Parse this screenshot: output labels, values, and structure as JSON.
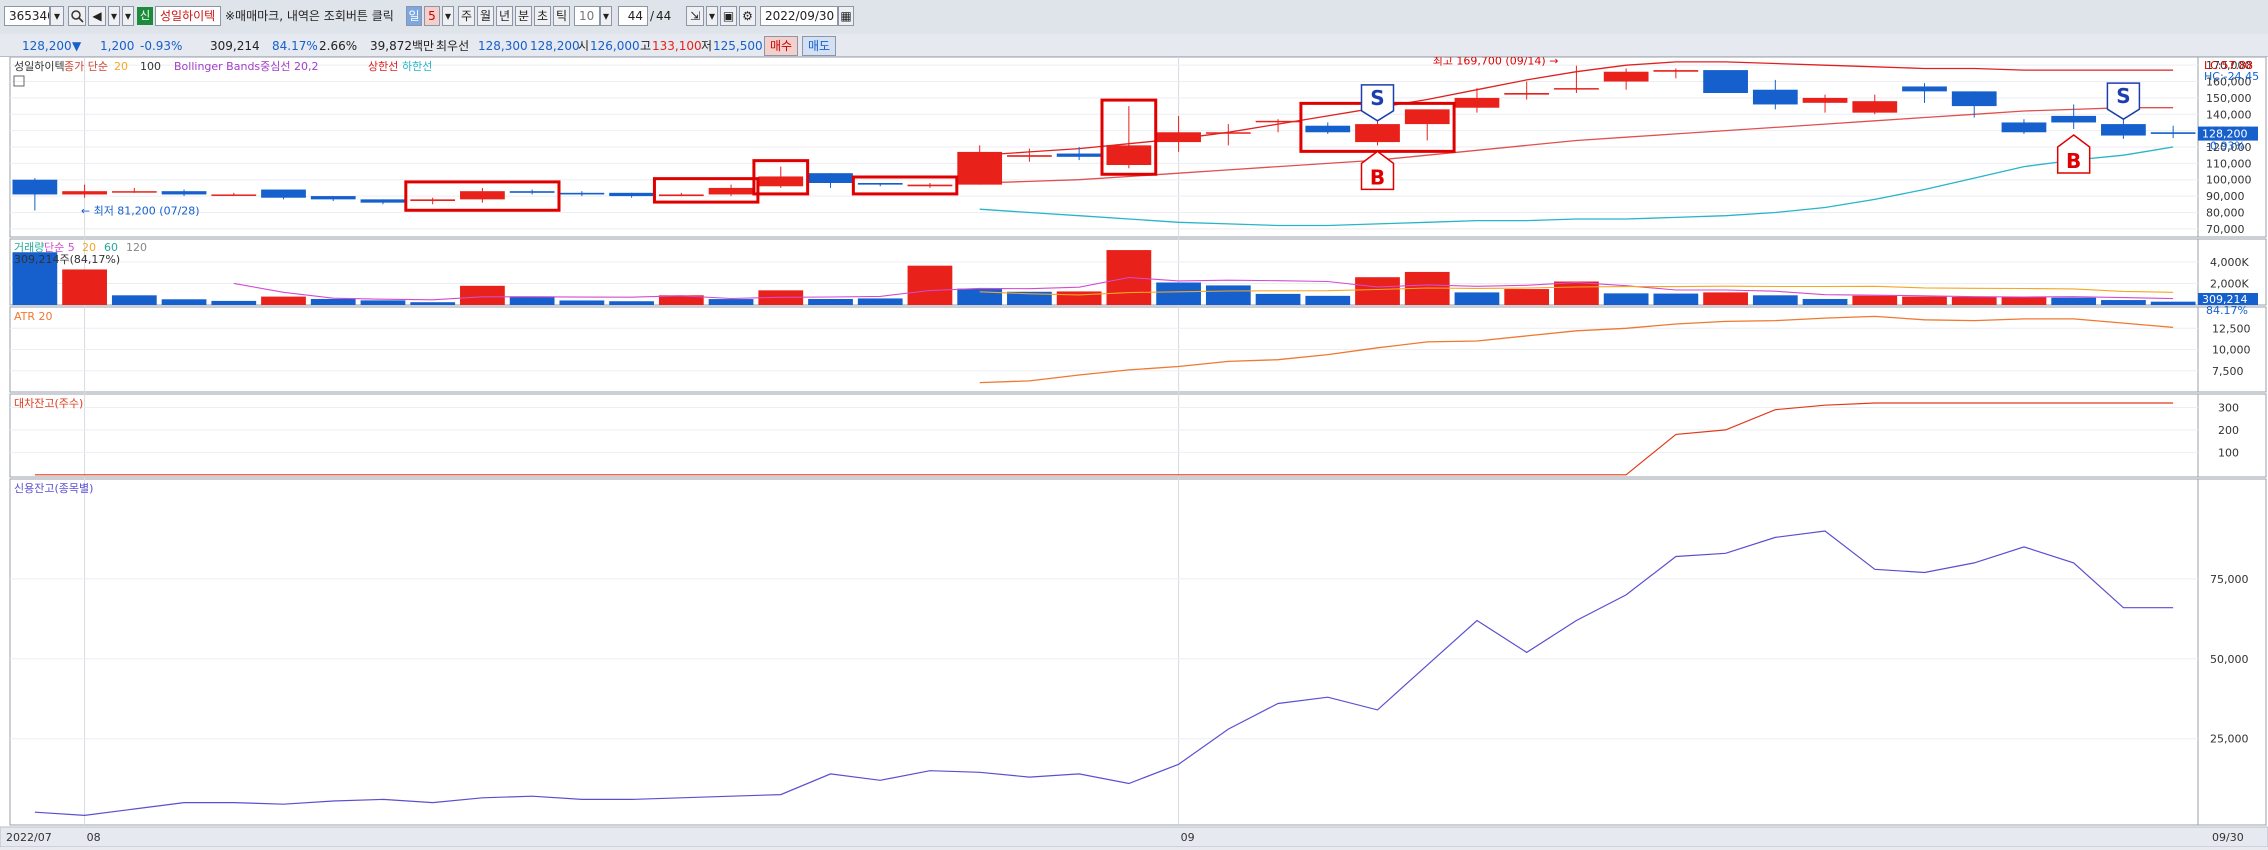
{
  "toolbar": {
    "code": "365340",
    "name_badge": "신",
    "name": "성일하이텍",
    "notice": "※매매마크, 내역은 조회버튼 클릭",
    "period_buttons": [
      "일",
      "5",
      "주",
      "월",
      "년",
      "분",
      "초",
      "틱"
    ],
    "tick_value": "10",
    "count": "44",
    "count_total": "44",
    "date": "2022/09/30"
  },
  "quote": {
    "price": "128,200",
    "arrow": "▼",
    "change": "1,200",
    "change_pct": "-0.93%",
    "volume": "309,214",
    "vol_ratio": "84.17%",
    "turnover": "2.66%",
    "amount": "39,872백만",
    "pref_label": "최우선",
    "best_ask": "128,300",
    "best_bid": "128,200",
    "open_label": "시",
    "open": "126,000",
    "high_label": "고",
    "high": "133,100",
    "low_label": "저",
    "low": "125,500",
    "buy_label": "매수",
    "sell_label": "매도"
  },
  "panels": {
    "price": {
      "name": "성일하이텍",
      "ma_label": "종가 단순",
      "ma1": "20",
      "ma2": "100",
      "bb_label": "Bollinger Bands중심선 20,2",
      "upper_label": "상한선",
      "lower_label": "하한선",
      "lc": "LC:57.88",
      "hc": "HC:-24.45",
      "max_annotation": "최고 169,700 (09/14)",
      "min_annotation": "최저 81,200 (07/28)",
      "last_price_tag": "128,200",
      "last_pct_tag": "-0.93%",
      "y_ticks": [
        "170,000",
        "160,000",
        "150,000",
        "140,000",
        "130,000",
        "120,000",
        "110,000",
        "100,000",
        "90,000",
        "80,000",
        "70,000"
      ]
    },
    "volume": {
      "name": "거래량",
      "ma_label": "단순 5",
      "ma2": "20",
      "ma3": "60",
      "ma4": "120",
      "last_label": "309,214주(84,17%)",
      "tag_value": "309,214",
      "tag_pct": "84.17%",
      "y_ticks": [
        "4,000K",
        "2,000K"
      ]
    },
    "atr": {
      "name": "ATR 20",
      "y_ticks": [
        "12,500",
        "10,000",
        "7,500"
      ]
    },
    "loan": {
      "name": "대차잔고(주수)",
      "y_ticks": [
        "300",
        "200",
        "100"
      ]
    },
    "credit": {
      "name": "신용잔고(종목별)",
      "y_ticks": [
        "75,000",
        "50,000",
        "25,000"
      ]
    }
  },
  "x_axis": {
    "start": "2022/07",
    "aug": "08",
    "sep": "09",
    "end": "09/30"
  },
  "signals": {
    "buy": "B",
    "sell": "S"
  },
  "colors": {
    "up": "#e8211b",
    "down": "#1560cc",
    "ma20": "#f5a623",
    "bb_upper": "#e02020",
    "bb_lower": "#27b5c8",
    "atr": "#f07830",
    "loan": "#e23a1a",
    "credit": "#5b4fd1"
  },
  "chart_data": [
    {
      "type": "candlestick",
      "title": "성일하이텍",
      "x": [
        "07/28",
        "07/29",
        "08/01",
        "08/02",
        "08/03",
        "08/04",
        "08/05",
        "08/08",
        "08/09",
        "08/10",
        "08/11",
        "08/12",
        "08/16",
        "08/17",
        "08/18",
        "08/19",
        "08/22",
        "08/23",
        "08/24",
        "08/25",
        "08/26",
        "08/29",
        "08/30",
        "08/31",
        "09/01",
        "09/02",
        "09/05",
        "09/06",
        "09/07",
        "09/08",
        "09/13",
        "09/14",
        "09/15",
        "09/16",
        "09/19",
        "09/20",
        "09/21",
        "09/22",
        "09/23",
        "09/26",
        "09/27",
        "09/28",
        "09/29",
        "09/30"
      ],
      "open": [
        100000,
        91000,
        93000,
        93000,
        91000,
        94000,
        90000,
        88000,
        87000,
        88000,
        93000,
        92000,
        92000,
        90000,
        91000,
        96000,
        104000,
        98000,
        96000,
        97000,
        114000,
        116000,
        109000,
        123000,
        129000,
        136000,
        133000,
        123000,
        134000,
        144000,
        152000,
        156000,
        160000,
        166000,
        167000,
        155000,
        147000,
        141000,
        157000,
        154000,
        135000,
        139000,
        134000,
        129000
      ],
      "close": [
        91000,
        93000,
        93000,
        91000,
        91000,
        89000,
        88000,
        86000,
        88000,
        93000,
        92000,
        91000,
        90000,
        91000,
        95000,
        102000,
        98000,
        97000,
        97000,
        117000,
        115000,
        114000,
        121000,
        129000,
        129000,
        136000,
        129000,
        134000,
        143000,
        150000,
        153000,
        156000,
        166000,
        167000,
        153000,
        146000,
        150000,
        148000,
        154000,
        145000,
        129000,
        135000,
        127000,
        128000
      ],
      "high": [
        101000,
        97000,
        95000,
        94000,
        92000,
        94000,
        90000,
        88000,
        89000,
        95000,
        94000,
        93000,
        92000,
        92000,
        97000,
        108000,
        104000,
        98000,
        98000,
        121000,
        119000,
        120000,
        145000,
        139000,
        134000,
        137000,
        135000,
        136000,
        143000,
        156000,
        160000,
        169700,
        168000,
        168000,
        167000,
        161000,
        152000,
        152000,
        159000,
        154000,
        137000,
        146000,
        137000,
        133000
      ],
      "low": [
        81200,
        89000,
        92000,
        90000,
        90000,
        88000,
        87000,
        85000,
        85000,
        86000,
        91000,
        90000,
        89000,
        90000,
        90000,
        95000,
        95000,
        96000,
        95000,
        97000,
        111000,
        112000,
        107000,
        117000,
        121000,
        129000,
        128000,
        121000,
        124000,
        141000,
        149000,
        153000,
        155000,
        162000,
        155000,
        143000,
        141000,
        140000,
        147000,
        138000,
        128000,
        131000,
        125000,
        125500
      ],
      "xlabel": "",
      "ylabel": "",
      "ylim": [
        65000,
        175000
      ],
      "bollinger_upper": [
        null,
        null,
        null,
        null,
        null,
        null,
        null,
        null,
        null,
        null,
        null,
        null,
        null,
        null,
        null,
        null,
        null,
        null,
        null,
        115000,
        117000,
        119000,
        122000,
        125000,
        129000,
        134000,
        139000,
        144000,
        149000,
        155000,
        161000,
        166000,
        170000,
        172000,
        172000,
        171000,
        170000,
        169000,
        168000,
        168000,
        167000,
        167000,
        167000,
        167000
      ],
      "bollinger_lower": [
        null,
        null,
        null,
        null,
        null,
        null,
        null,
        null,
        null,
        null,
        null,
        null,
        null,
        null,
        null,
        null,
        null,
        null,
        null,
        82000,
        80000,
        78000,
        76000,
        74000,
        73000,
        72000,
        72000,
        73000,
        74000,
        75000,
        75000,
        76000,
        76000,
        77000,
        78000,
        80000,
        83000,
        88000,
        94000,
        101000,
        108000,
        112000,
        115000,
        120000
      ],
      "ma100": [
        null,
        null,
        null,
        null,
        null,
        null,
        null,
        null,
        null,
        null,
        null,
        null,
        null,
        null,
        null,
        null,
        null,
        null,
        null,
        98000,
        99000,
        100000,
        102000,
        104000,
        106000,
        108000,
        110000,
        112000,
        115000,
        118000,
        121000,
        124000,
        126000,
        128000,
        130000,
        132000,
        134000,
        136000,
        138000,
        140000,
        142000,
        143000,
        144000,
        144000
      ],
      "signals": [
        {
          "x": "09/06",
          "type": "S"
        },
        {
          "x": "09/06",
          "type": "B"
        },
        {
          "x": "09/29",
          "type": "S"
        },
        {
          "x": "09/28",
          "type": "B"
        }
      ]
    },
    {
      "type": "bar",
      "title": "거래량",
      "x": [
        "07/28",
        "07/29",
        "08/01",
        "08/02",
        "08/03",
        "08/04",
        "08/05",
        "08/08",
        "08/09",
        "08/10",
        "08/11",
        "08/12",
        "08/16",
        "08/17",
        "08/18",
        "08/19",
        "08/22",
        "08/23",
        "08/24",
        "08/25",
        "08/26",
        "08/29",
        "08/30",
        "08/31",
        "09/01",
        "09/02",
        "09/05",
        "09/06",
        "09/07",
        "09/08",
        "09/13",
        "09/14",
        "09/15",
        "09/16",
        "09/19",
        "09/20",
        "09/21",
        "09/22",
        "09/23",
        "09/26",
        "09/27",
        "09/28",
        "09/29",
        "09/30"
      ],
      "values": [
        4900000,
        3300000,
        900000,
        530000,
        380000,
        780000,
        560000,
        430000,
        260000,
        1780000,
        800000,
        420000,
        350000,
        900000,
        550000,
        1360000,
        560000,
        610000,
        3650000,
        1520000,
        1230000,
        1260000,
        5100000,
        2090000,
        1820000,
        1030000,
        850000,
        2580000,
        3070000,
        1170000,
        1480000,
        2180000,
        1080000,
        1060000,
        1170000,
        900000,
        560000,
        860000,
        780000,
        740000,
        780000,
        680000,
        460000,
        309214
      ],
      "up": [
        false,
        true,
        false,
        false,
        false,
        true,
        false,
        false,
        false,
        true,
        false,
        false,
        false,
        true,
        false,
        true,
        false,
        false,
        true,
        false,
        false,
        true,
        true,
        false,
        false,
        false,
        false,
        true,
        true,
        false,
        true,
        true,
        false,
        false,
        true,
        false,
        false,
        true,
        true,
        true,
        true,
        false,
        false,
        false
      ],
      "ylim": [
        0,
        5200000
      ]
    },
    {
      "type": "line",
      "title": "ATR 20",
      "x": [
        "08/25",
        "08/26",
        "08/29",
        "08/30",
        "08/31",
        "09/01",
        "09/02",
        "09/05",
        "09/06",
        "09/07",
        "09/08",
        "09/13",
        "09/14",
        "09/15",
        "09/16",
        "09/19",
        "09/20",
        "09/21",
        "09/22",
        "09/23",
        "09/26",
        "09/27",
        "09/28",
        "09/29",
        "09/30"
      ],
      "values": [
        6100,
        6300,
        7000,
        7600,
        8000,
        8600,
        8800,
        9400,
        10200,
        10900,
        11000,
        11600,
        12200,
        12500,
        13000,
        13300,
        13400,
        13700,
        13900,
        13500,
        13400,
        13600,
        13600,
        13100,
        12600
      ],
      "ylim": [
        5000,
        15000
      ]
    },
    {
      "type": "line",
      "title": "대차잔고(주수)",
      "x": [
        "07/28",
        "09/15",
        "09/16",
        "09/19",
        "09/20",
        "09/21",
        "09/22",
        "09/23",
        "09/26",
        "09/27",
        "09/28",
        "09/29",
        "09/30"
      ],
      "values": [
        0,
        0,
        180,
        200,
        290,
        310,
        320,
        320,
        320,
        320,
        320,
        320,
        320
      ],
      "ylim": [
        -10,
        360
      ]
    },
    {
      "type": "line",
      "title": "신용잔고(종목별)",
      "x": [
        "07/28",
        "07/29",
        "08/01",
        "08/02",
        "08/03",
        "08/04",
        "08/05",
        "08/08",
        "08/09",
        "08/10",
        "08/11",
        "08/12",
        "08/16",
        "08/17",
        "08/18",
        "08/19",
        "08/22",
        "08/23",
        "08/24",
        "08/25",
        "08/26",
        "08/29",
        "08/30",
        "08/31",
        "09/01",
        "09/02",
        "09/05",
        "09/06",
        "09/07",
        "09/08",
        "09/13",
        "09/14",
        "09/15",
        "09/16",
        "09/19",
        "09/20",
        "09/21",
        "09/22",
        "09/23",
        "09/26",
        "09/27",
        "09/28",
        "09/29",
        "09/30"
      ],
      "values": [
        2000,
        1000,
        3000,
        5000,
        5000,
        4500,
        5500,
        6000,
        5000,
        6500,
        7000,
        6000,
        6000,
        6500,
        7000,
        7500,
        14000,
        12000,
        15000,
        14500,
        13000,
        14000,
        11000,
        17000,
        28000,
        36000,
        38000,
        34000,
        48000,
        62000,
        52000,
        62000,
        70000,
        82000,
        83000,
        88000,
        90000,
        78000,
        77000,
        80000,
        85000,
        80000,
        66000,
        66000
      ],
      "ylim": [
        -2000,
        100000
      ]
    }
  ]
}
